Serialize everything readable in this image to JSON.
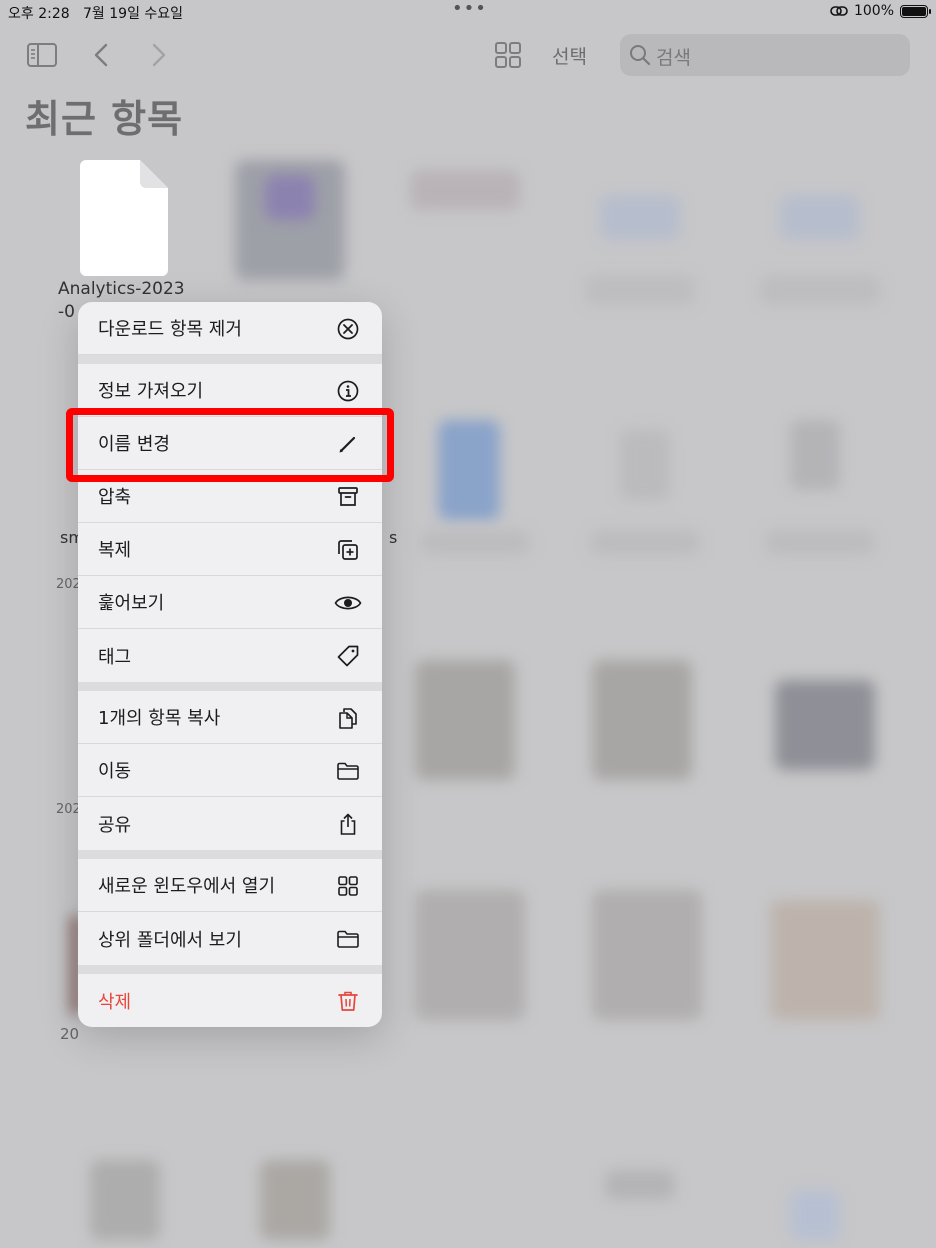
{
  "status": {
    "time": "오후 2:28",
    "date": "7월 19일 수요일",
    "battery": "100%"
  },
  "toolbar": {
    "select_label": "선택",
    "search_placeholder": "검색"
  },
  "page": {
    "title": "최근 항목"
  },
  "file": {
    "name_line1": "Analytics-2023",
    "name_line2": "-0"
  },
  "fragments": {
    "sm": "sm",
    "s": "s",
    "y1": "202",
    "y2": "202",
    "y3": "20"
  },
  "menu": {
    "groups": [
      [
        {
          "label": "다운로드 항목 제거",
          "icon": "x-circle-icon"
        }
      ],
      [
        {
          "label": "정보 가져오기",
          "icon": "info-icon"
        },
        {
          "label": "이름 변경",
          "icon": "pencil-icon"
        },
        {
          "label": "압축",
          "icon": "archive-icon"
        },
        {
          "label": "복제",
          "icon": "duplicate-icon"
        },
        {
          "label": "훑어보기",
          "icon": "eye-icon"
        },
        {
          "label": "태그",
          "icon": "tag-icon"
        }
      ],
      [
        {
          "label": "1개의 항목 복사",
          "icon": "copy-icon"
        },
        {
          "label": "이동",
          "icon": "folder-icon"
        },
        {
          "label": "공유",
          "icon": "share-icon"
        }
      ],
      [
        {
          "label": "새로운 윈도우에서 열기",
          "icon": "grid-icon"
        },
        {
          "label": "상위 폴더에서 보기",
          "icon": "folder-icon"
        }
      ],
      [
        {
          "label": "삭제",
          "icon": "trash-icon",
          "destructive": true
        }
      ]
    ]
  },
  "highlight_color": "#ff0000",
  "destructive_color": "#e8463b"
}
